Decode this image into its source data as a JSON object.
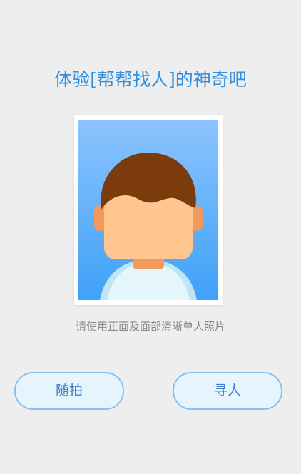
{
  "page": {
    "title": "体验[帮帮找人]的神奇吧",
    "hint": "请使用正面及面部清晰单人照片"
  },
  "buttons": {
    "take_photo_label": "随拍",
    "search_person_label": "寻人"
  },
  "illustration": {
    "icon": "person-avatar-icon",
    "colors": {
      "background_top": "#8cc4ff",
      "background_bottom": "#3fa1f7",
      "hair": "#7b3b0c",
      "skin": "#ffc690",
      "ears_neck": "#f29a5b",
      "shirt": "#e4f5fc"
    }
  },
  "colors": {
    "accent": "#2f8fe0",
    "button_border": "#86c0f2",
    "button_bg": "#e6f5fd",
    "page_bg": "#eeeeee",
    "hint_text": "#8a8a8a"
  }
}
